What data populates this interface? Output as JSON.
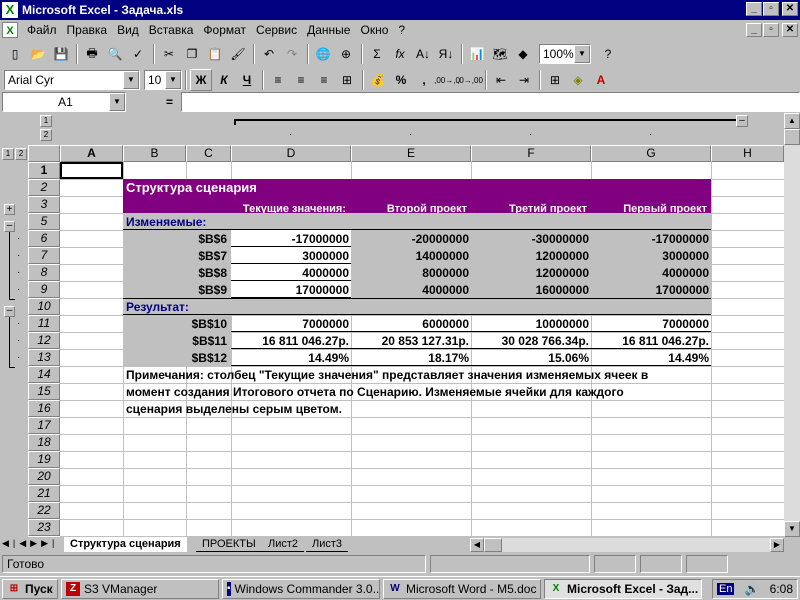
{
  "window": {
    "title": "Microsoft Excel - Задача.xls",
    "app_icon": "excel-icon"
  },
  "menu": [
    "Файл",
    "Правка",
    "Вид",
    "Вставка",
    "Формат",
    "Сервис",
    "Данные",
    "Окно",
    "?"
  ],
  "toolbar": {
    "zoom": "100%"
  },
  "format": {
    "font": "Arial Cyr",
    "size": "10",
    "bold": "Ж",
    "italic": "К",
    "underline": "Ч",
    "percent": "%",
    "comma": ",",
    "inc_decimal": ",00→,0",
    "dec_decimal": ",0→,00"
  },
  "formula_bar": {
    "name_box": "A1",
    "equals": "=",
    "value": ""
  },
  "outline": {
    "level_col": [
      "1",
      "2"
    ],
    "level_row": [
      "1",
      "2"
    ]
  },
  "columns": [
    "A",
    "B",
    "C",
    "D",
    "E",
    "F",
    "G",
    "H"
  ],
  "rows": [
    "1",
    "2",
    "3",
    "5",
    "6",
    "7",
    "8",
    "9",
    "10",
    "11",
    "12",
    "13",
    "14",
    "15",
    "16",
    "17",
    "18",
    "19",
    "20",
    "21",
    "22",
    "23"
  ],
  "scenario": {
    "title": "Структура сценария",
    "headers": [
      "Текущие значения:",
      "Второй проект",
      "Третий проект",
      "Первый проект"
    ],
    "changing_label": "Изменяемые:",
    "changing": [
      {
        "cell": "$B$6",
        "values": [
          "-17000000",
          "-20000000",
          "-30000000",
          "-17000000"
        ]
      },
      {
        "cell": "$B$7",
        "values": [
          "3000000",
          "14000000",
          "12000000",
          "3000000"
        ]
      },
      {
        "cell": "$B$8",
        "values": [
          "4000000",
          "8000000",
          "12000000",
          "4000000"
        ]
      },
      {
        "cell": "$B$9",
        "values": [
          "17000000",
          "4000000",
          "16000000",
          "17000000"
        ]
      }
    ],
    "result_label": "Результат:",
    "results": [
      {
        "cell": "$B$10",
        "values": [
          "7000000",
          "6000000",
          "10000000",
          "7000000"
        ]
      },
      {
        "cell": "$B$11",
        "values": [
          "16 811 046.27р.",
          "20 853 127.31р.",
          "30 028 766.34р.",
          "16 811 046.27р."
        ]
      },
      {
        "cell": "$B$12",
        "values": [
          "14.49%",
          "18.17%",
          "15.06%",
          "14.49%"
        ]
      }
    ],
    "note": [
      "Примечания: столбец \"Текущие значения\" представляет значения изменяемых ячеек в",
      "момент создания Итогового отчета по Сценарию. Изменяемые ячейки для каждого",
      "сценария выделены серым цветом."
    ]
  },
  "tabs": [
    "Структура сценария",
    "ПРОЕКТЫ",
    "Лист2",
    "Лист3"
  ],
  "status": "Готово",
  "taskbar": {
    "start": "Пуск",
    "tasks": [
      "S3 VManager",
      "Windows Commander 3.0...",
      "Microsoft Word - M5.doc",
      "Microsoft Excel - Зад..."
    ],
    "lang": "En",
    "clock": "6:08"
  },
  "colors": {
    "title_bg": "#000080",
    "scenario_header": "#800080",
    "changing_cells": "#c0c0c0"
  }
}
